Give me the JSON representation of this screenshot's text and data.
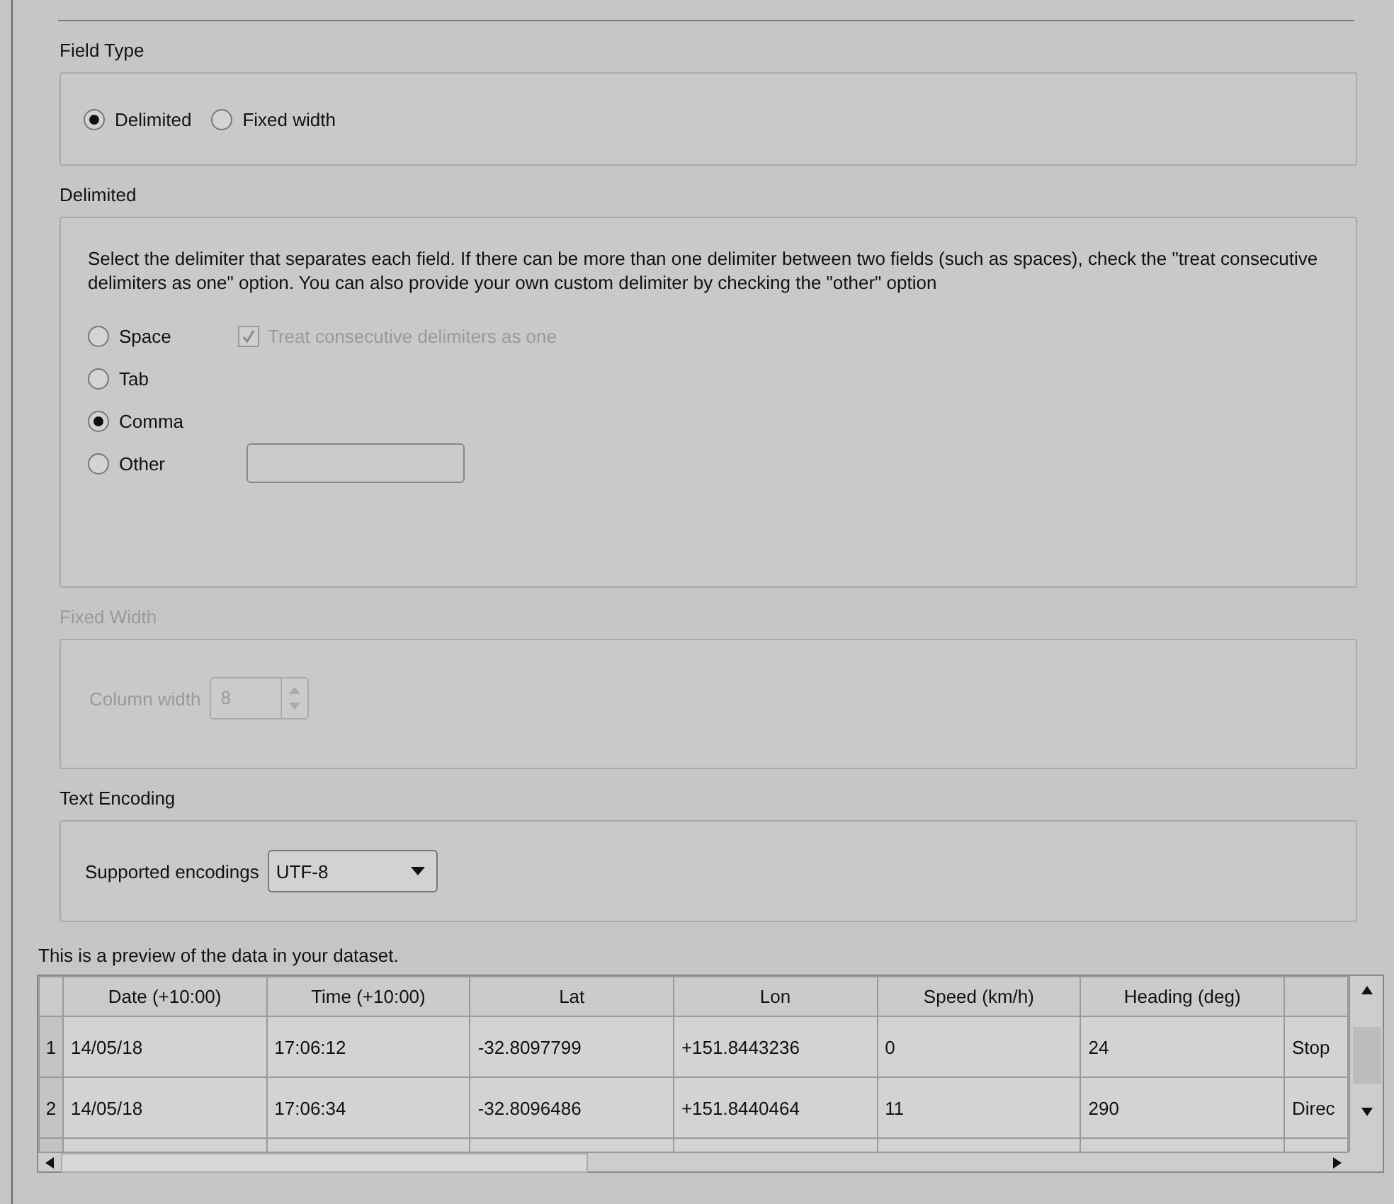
{
  "field_type": {
    "title": "Field Type",
    "options": [
      {
        "label": "Delimited",
        "selected": true
      },
      {
        "label": "Fixed width",
        "selected": false
      }
    ]
  },
  "delimited": {
    "title": "Delimited",
    "description": "Select the delimiter that separates each field.  If there can be more than one delimiter between two fields (such as spaces), check the \"treat consecutive delimiters as one\" option.  You can also provide your own custom delimiter by checking the \"other\" option",
    "options": [
      {
        "label": "Space",
        "selected": false
      },
      {
        "label": "Tab",
        "selected": false
      },
      {
        "label": "Comma",
        "selected": true
      },
      {
        "label": "Other",
        "selected": false
      }
    ],
    "treat_consecutive": {
      "label": "Treat consecutive delimiters as one",
      "checked": true,
      "disabled": true
    }
  },
  "fixed_width": {
    "title": "Fixed Width",
    "disabled": true,
    "column_width": {
      "label": "Column width",
      "value": "8"
    }
  },
  "text_encoding": {
    "title": "Text Encoding",
    "label": "Supported encodings",
    "value": "UTF-8"
  },
  "preview": {
    "caption": "This is a preview of the data in your dataset.",
    "columns": [
      "Date (+10:00)",
      "Time (+10:00)",
      "Lat",
      "Lon",
      "Speed (km/h)",
      "Heading (deg)"
    ],
    "rows": [
      {
        "number": "1",
        "cells": [
          "14/05/18",
          "17:06:12",
          "-32.8097799",
          "+151.8443236",
          "0",
          "24",
          "Stop"
        ]
      },
      {
        "number": "2",
        "cells": [
          "14/05/18",
          "17:06:34",
          "-32.8096486",
          "+151.8440464",
          "11",
          "290",
          "Direc"
        ]
      }
    ]
  }
}
